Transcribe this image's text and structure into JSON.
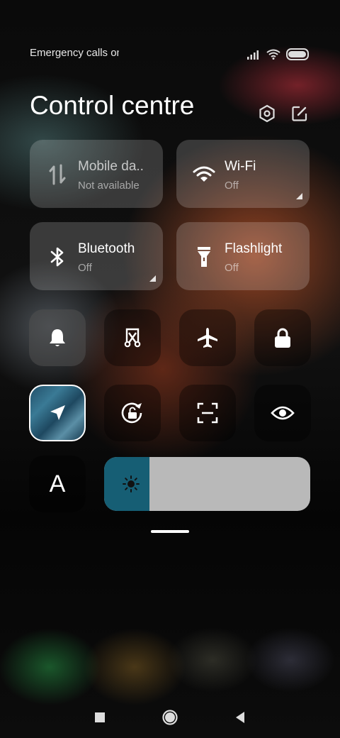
{
  "status_bar": {
    "carrier_text": "Emergency calls only",
    "battery_level": 0.95
  },
  "header": {
    "title": "Control centre",
    "icons": [
      "settings-icon",
      "edit-icon"
    ]
  },
  "tiles": [
    {
      "name": "Mobile da..",
      "state": "Not available",
      "icon": "mobile-data-icon"
    },
    {
      "name": "Wi-Fi",
      "state": "Off",
      "icon": "wifi-icon"
    },
    {
      "name": "Bluetooth",
      "state": "Off",
      "icon": "bluetooth-icon"
    },
    {
      "name": "Flashlight",
      "state": "Off",
      "icon": "flashlight-icon"
    }
  ],
  "toggles_row1": [
    "bell-icon",
    "screenshot-icon",
    "airplane-icon",
    "lock-icon"
  ],
  "toggles_row2": [
    "location-icon",
    "rotation-lock-icon",
    "scan-icon",
    "eye-icon"
  ],
  "font_button_label": "A",
  "brightness": {
    "level_percent": 22,
    "icon": "sun-icon"
  },
  "colors": {
    "brightness_fill": "#165e74",
    "brightness_track": "#b9b9b9",
    "active_tile_accent": "#3a7a95"
  },
  "nav_bar": [
    "recents-icon",
    "home-icon",
    "back-icon"
  ]
}
